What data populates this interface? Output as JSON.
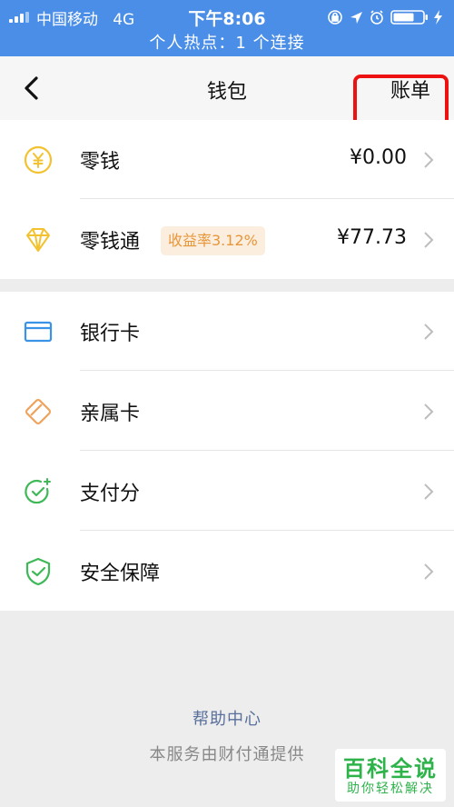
{
  "status_bar": {
    "carrier": "中国移动",
    "network": "4G",
    "time": "下午8:06",
    "hotspot_text": "个人热点：1 个连接",
    "icons": [
      "signal-icon",
      "lock-rotation-icon",
      "location-icon",
      "alarm-icon",
      "battery-icon",
      "charging-icon"
    ]
  },
  "nav": {
    "title": "钱包",
    "right_action": "账单",
    "back_icon": "chevron-left-icon"
  },
  "wallet_section": [
    {
      "label": "零钱",
      "value": "¥0.00",
      "icon": "yuan-coin-icon"
    },
    {
      "label": "零钱通",
      "badge": "收益率3.12%",
      "value": "¥77.73",
      "icon": "diamond-icon"
    }
  ],
  "service_section": [
    {
      "label": "银行卡",
      "icon": "bank-card-icon"
    },
    {
      "label": "亲属卡",
      "icon": "family-card-icon"
    },
    {
      "label": "支付分",
      "icon": "pay-score-icon"
    },
    {
      "label": "安全保障",
      "icon": "shield-icon"
    }
  ],
  "footer": {
    "help": "帮助中心",
    "provider": "本服务由财付通提供"
  },
  "watermark": {
    "main": "百科全说",
    "sub": "助你轻松解决"
  },
  "colors": {
    "status_bar": "#4b8ee8",
    "accent_yellow": "#f2c230",
    "badge_bg": "#fbeede",
    "badge_text": "#e8963a",
    "annotation": "#e11111",
    "link": "#59709b",
    "watermark": "#2db34a"
  }
}
